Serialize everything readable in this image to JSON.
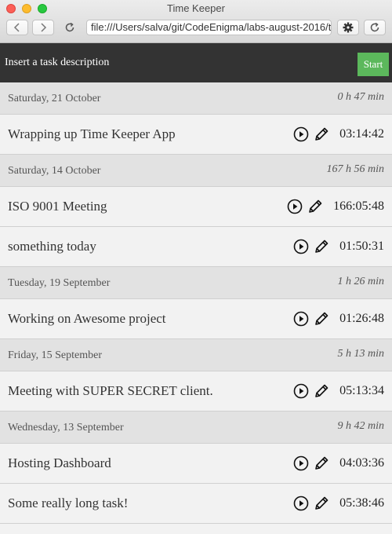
{
  "window": {
    "title": "Time Keeper",
    "url": "file:///Users/salva/git/CodeEnigma/labs-august-2016/t"
  },
  "header": {
    "input_placeholder": "Insert a task description",
    "start_label": "Start"
  },
  "days": [
    {
      "date": "Saturday, 21 October",
      "total": "0 h 47 min",
      "tasks": [
        {
          "name": "Wrapping up Time Keeper App",
          "time": "03:14:42"
        }
      ]
    },
    {
      "date": "Saturday, 14 October",
      "total": "167 h 56 min",
      "tasks": [
        {
          "name": "ISO 9001 Meeting",
          "time": "166:05:48"
        },
        {
          "name": "something today",
          "time": "01:50:31"
        }
      ]
    },
    {
      "date": "Tuesday, 19 September",
      "total": "1 h 26 min",
      "tasks": [
        {
          "name": "Working on Awesome project",
          "time": "01:26:48"
        }
      ]
    },
    {
      "date": "Friday, 15 September",
      "total": "5 h 13 min",
      "tasks": [
        {
          "name": "Meeting with SUPER SECRET client.",
          "time": "05:13:34"
        }
      ]
    },
    {
      "date": "Wednesday, 13 September",
      "total": "9 h 42 min",
      "tasks": [
        {
          "name": "Hosting Dashboard",
          "time": "04:03:36"
        },
        {
          "name": "Some really long task!",
          "time": "05:38:46"
        }
      ]
    }
  ],
  "icons": {
    "play": "play-circle-icon",
    "edit": "pencil-icon"
  }
}
